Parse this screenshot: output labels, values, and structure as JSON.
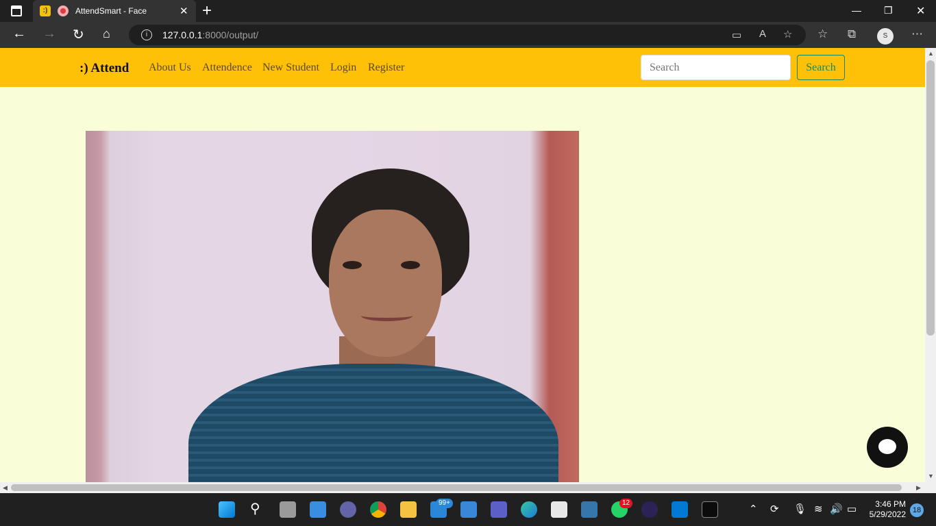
{
  "browser": {
    "tab_title": "AttendSmart - Face",
    "tab_favicon": ":)",
    "address_host": "127.0.0.1",
    "address_rest": ":8000/output/",
    "profile_initial": "S"
  },
  "site": {
    "brand": ":) Attend",
    "nav_links": [
      "About Us",
      "Attendence",
      "New Student",
      "Login",
      "Register"
    ],
    "search_placeholder": "Search",
    "search_button": "Search",
    "accent_color": "#ffc107",
    "background_color": "#fafed8"
  },
  "taskbar": {
    "mail_badge": "99+",
    "whatsapp_badge": "12",
    "time": "3:46 PM",
    "date": "5/29/2022",
    "notification_count": "18"
  }
}
